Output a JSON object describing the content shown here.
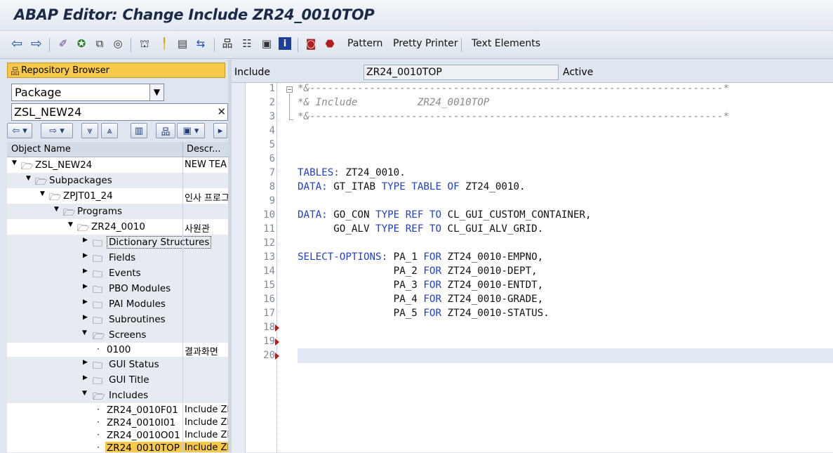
{
  "window": {
    "title": "ABAP Editor: Change Include ZR24_0010TOP"
  },
  "toolbar": {
    "buttons": [
      "Pattern",
      "Pretty Printer",
      "Text Elements"
    ],
    "icons": [
      "back-arrow-icon",
      "forward-arrow-icon",
      "check-icon",
      "activate-icon",
      "object-list-icon",
      "where-used-icon",
      "hierarchy-icon",
      "breakpoint-icon",
      "display-object-icon",
      "navigate-icon",
      "tree-icon",
      "table-icon",
      "window-icon",
      "info-icon",
      "help-icon",
      "stop-icon"
    ]
  },
  "repository": {
    "header": "Repository Browser",
    "type_select": "Package",
    "package_input": "ZSL_NEW24",
    "columns": {
      "name": "Object Name",
      "desc": "Descr..."
    },
    "tree": [
      {
        "label": "ZSL_NEW24",
        "desc": "NEW TEA"
      },
      {
        "label": "Subpackages",
        "desc": ""
      },
      {
        "label": "ZPJT01_24",
        "desc": "인사 프로그"
      },
      {
        "label": "Programs",
        "desc": ""
      },
      {
        "label": "ZR24_0010",
        "desc": "사원관"
      },
      {
        "label": "Dictionary Structures",
        "desc": ""
      },
      {
        "label": "Fields",
        "desc": ""
      },
      {
        "label": "Events",
        "desc": ""
      },
      {
        "label": "PBO Modules",
        "desc": ""
      },
      {
        "label": "PAI Modules",
        "desc": ""
      },
      {
        "label": "Subroutines",
        "desc": ""
      },
      {
        "label": "Screens",
        "desc": ""
      },
      {
        "label": "0100",
        "desc": "결과화면"
      },
      {
        "label": "GUI Status",
        "desc": ""
      },
      {
        "label": "GUI Title",
        "desc": ""
      },
      {
        "label": "Includes",
        "desc": ""
      },
      {
        "label": "ZR24_0010F01",
        "desc": "Include ZI"
      },
      {
        "label": "ZR24_0010I01",
        "desc": "Include ZI"
      },
      {
        "label": "ZR24_0010O01",
        "desc": "Include ZI"
      },
      {
        "label": "ZR24_0010TOP",
        "desc": "Include ZI"
      }
    ]
  },
  "editor": {
    "type_label": "Include",
    "include_name": "ZR24_0010TOP",
    "status": "Active",
    "line_numbers": [
      "1",
      "2",
      "3",
      "4",
      "5",
      "6",
      "7",
      "8",
      "9",
      "10",
      "11",
      "12",
      "13",
      "14",
      "15",
      "16",
      "17",
      "18",
      "19",
      "20"
    ],
    "lines": {
      "l1": "*&---------------------------------------------------------------------*",
      "l2": "*& Include          ZR24_0010TOP",
      "l3": "*&---------------------------------------------------------------------*",
      "l7a": "TABLES:",
      "l7b": " ZT24_0010.",
      "l8a": "DATA:",
      "l8b": " GT_ITAB ",
      "l8c": "TYPE TABLE OF",
      "l8d": " ZT24_0010.",
      "l10a": "DATA:",
      "l10b": " GO_CON ",
      "l10c": "TYPE REF TO",
      "l10d": " CL_GUI_CUSTOM_CONTAINER,",
      "l11a": "      GO_ALV ",
      "l11b": "TYPE REF TO",
      "l11c": " CL_GUI_ALV_GRID.",
      "l13a": "SELECT-OPTIONS:",
      "l13b": " PA_1 ",
      "l13c": "FOR",
      "l13d": " ZT24_0010-EMPNO,",
      "l14a": "                PA_2 ",
      "l14b": "FOR",
      "l14c": " ZT24_0010-DEPT,",
      "l15a": "                PA_3 ",
      "l15b": "FOR",
      "l15c": " ZT24_0010-ENTDT,",
      "l16a": "                PA_4 ",
      "l16b": "FOR",
      "l16c": " ZT24_0010-GRADE,",
      "l17a": "                PA_5 ",
      "l17b": "FOR",
      "l17c": " ZT24_0010-STATUS."
    }
  }
}
